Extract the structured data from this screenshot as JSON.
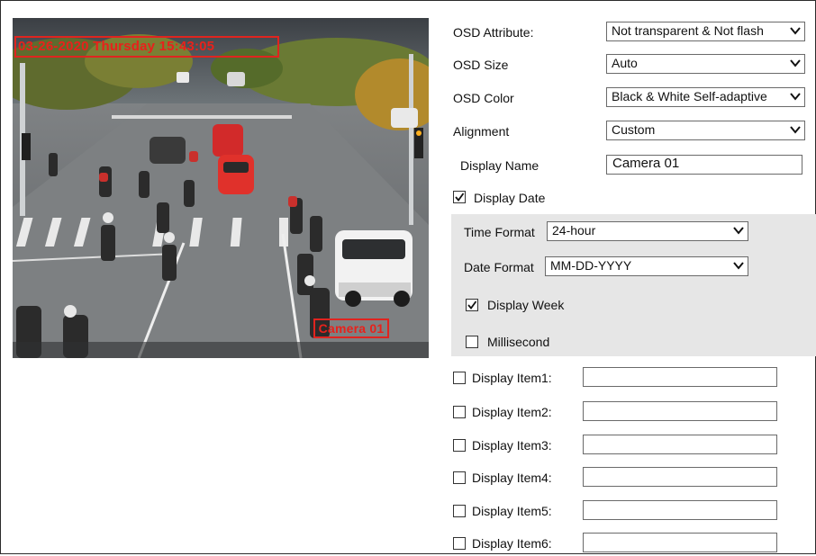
{
  "preview": {
    "osd_date_text": "03-26-2020 Thursday 15:43:05",
    "osd_name_text": "Camera 01"
  },
  "osd": {
    "attribute": {
      "label": "OSD Attribute:",
      "value": "Not transparent & Not flash"
    },
    "size": {
      "label": "OSD Size",
      "value": "Auto"
    },
    "color": {
      "label": "OSD Color",
      "value": "Black & White Self-adaptive"
    },
    "alignment": {
      "label": "Alignment",
      "value": "Custom"
    },
    "display_name": {
      "label": "Display Name",
      "value": "Camera 01",
      "checked": false
    },
    "display_date": {
      "label": "Display Date",
      "checked": true
    },
    "time_format": {
      "label": "Time Format",
      "value": "24-hour"
    },
    "date_format": {
      "label": "Date Format",
      "value": "MM-DD-YYYY"
    },
    "display_week": {
      "label": "Display Week",
      "checked": true
    },
    "millisecond": {
      "label": "Millisecond",
      "checked": false
    }
  },
  "items": [
    {
      "label": "Display Item1:",
      "checked": false,
      "value": ""
    },
    {
      "label": "Display Item2:",
      "checked": false,
      "value": ""
    },
    {
      "label": "Display Item3:",
      "checked": false,
      "value": ""
    },
    {
      "label": "Display Item4:",
      "checked": false,
      "value": ""
    },
    {
      "label": "Display Item5:",
      "checked": false,
      "value": ""
    },
    {
      "label": "Display Item6:",
      "checked": false,
      "value": ""
    }
  ],
  "colors": {
    "osd_red": "#e0241f",
    "group_bg": "#e6e6e6",
    "border": "#6a6a6a"
  },
  "icons": [
    "chevron-down-icon",
    "checkmark-icon"
  ]
}
